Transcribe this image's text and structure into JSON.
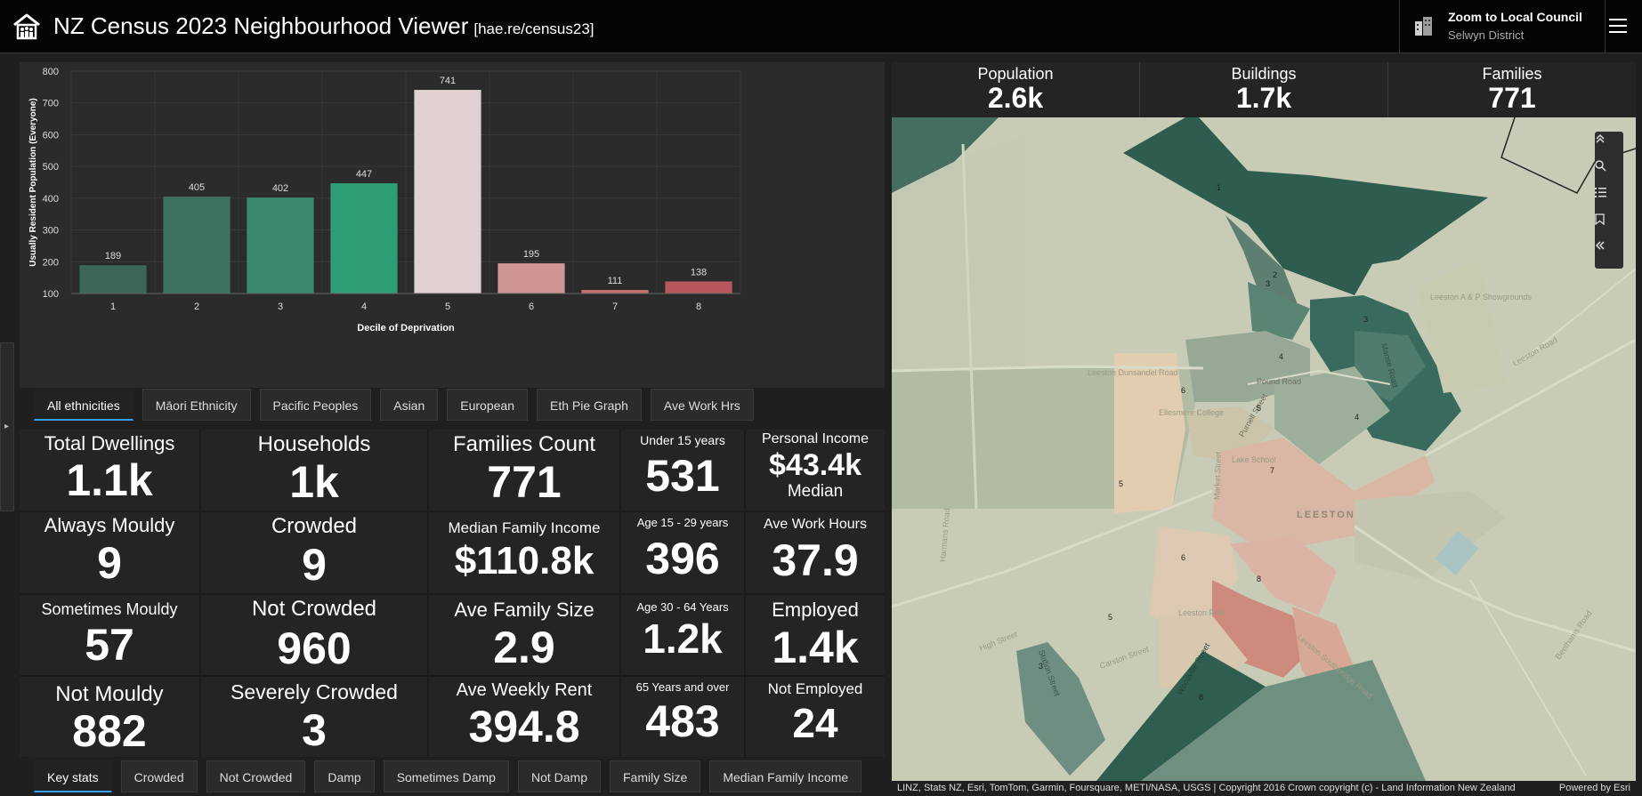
{
  "header": {
    "title": "NZ Census 2023 Neighbourhood Viewer",
    "url": "[hae.re/census23]",
    "zoom_title": "Zoom to Local Council",
    "zoom_value": "Selwyn District"
  },
  "chart_data": {
    "type": "bar",
    "categories": [
      "1",
      "2",
      "3",
      "4",
      "5",
      "6",
      "7",
      "8"
    ],
    "values": [
      189,
      405,
      402,
      447,
      741,
      195,
      111,
      138
    ],
    "colors": [
      "#3c6655",
      "#3e7260",
      "#3a8a6e",
      "#2e9e74",
      "#e0d0d2",
      "#cf9494",
      "#c47272",
      "#b8575d"
    ],
    "xlabel": "Decile of Deprivation",
    "ylabel": "Usually Resident Population (Everyone)",
    "ylim": [
      100,
      800
    ],
    "yticks": [
      100,
      200,
      300,
      400,
      500,
      600,
      700,
      800
    ],
    "grid": true
  },
  "tabs_top": [
    "All ethnicities",
    "Māori Ethnicity",
    "Pacific Peoples",
    "Asian",
    "European",
    "Eth Pie Graph",
    "Ave Work Hrs"
  ],
  "stats": {
    "col1": [
      {
        "label": "Total Dwellings",
        "value": "1.1k"
      },
      {
        "label": "Always Mouldy",
        "value": "9"
      },
      {
        "label": "Sometimes Mouldy",
        "value": "57"
      },
      {
        "label": "Not Mouldy",
        "value": "882"
      }
    ],
    "col2": [
      {
        "label": "Households",
        "value": "1k"
      },
      {
        "label": "Crowded",
        "value": "9"
      },
      {
        "label": "Not Crowded",
        "value": "960"
      },
      {
        "label": "Severely Crowded",
        "value": "3"
      }
    ],
    "col3": [
      {
        "label": "Families Count",
        "value": "771"
      },
      {
        "label": "Median Family Income",
        "value": "$110.8k"
      },
      {
        "label": "Ave Family Size",
        "value": "2.9"
      },
      {
        "label": "Ave Weekly Rent",
        "value": "394.8"
      }
    ],
    "col4": [
      {
        "label": "Under 15 years",
        "value": "531"
      },
      {
        "label": "Age 15 - 29 years",
        "value": "396"
      },
      {
        "label": "Age 30 - 64 Years",
        "value": "1.2k"
      },
      {
        "label": "65 Years and over",
        "value": "483"
      }
    ],
    "col5": [
      {
        "label": "Personal Income",
        "value": "$43.4k",
        "sub": "Median"
      },
      {
        "label": "Ave Work Hours",
        "value": "37.9"
      },
      {
        "label": "Employed",
        "value": "1.4k"
      },
      {
        "label": "Not Employed",
        "value": "24"
      }
    ]
  },
  "tabs_bottom": [
    "Key stats",
    "Crowded",
    "Not Crowded",
    "Damp",
    "Sometimes Damp",
    "Not Damp",
    "Family Size",
    "Median Family Income"
  ],
  "kpis": [
    {
      "label": "Population",
      "value": "2.6k"
    },
    {
      "label": "Buildings",
      "value": "1.7k"
    },
    {
      "label": "Families",
      "value": "771"
    }
  ],
  "map": {
    "area_labels": {
      "town": "LEESTON",
      "school": "Ellesmere College",
      "lake": "Lake School",
      "showgrounds": "Leeston A & P Showgrounds",
      "lp": "Leeston Park"
    },
    "street_labels": {
      "leeston_dunsandel": "Leeston Dunsandel Road",
      "pound": "Pound Road",
      "harmans": "Harmans Road",
      "high": "High Street",
      "market": "Market Street",
      "purnell": "Purnell Street",
      "leeston_rd": "Leeston Road",
      "manse": "Manse Road",
      "carston": "Carston Street",
      "woodville": "Woodville Street",
      "station": "Station Street",
      "beethams": "Beethams Road",
      "leeston_south": "Leeston Southbridge Road"
    },
    "polygon_numbers": [
      "1",
      "2",
      "3",
      "4",
      "4",
      "5",
      "5",
      "5",
      "6",
      "6",
      "7",
      "8",
      "8",
      "3",
      "3"
    ],
    "attribution": "LINZ, Stats NZ, Esri, TomTom, Garmin, Foursquare, METI/NASA, USGS | Copyright 2016 Crown copyright (c) - Land Information New Zealand",
    "powered_by": "Powered by Esri"
  }
}
